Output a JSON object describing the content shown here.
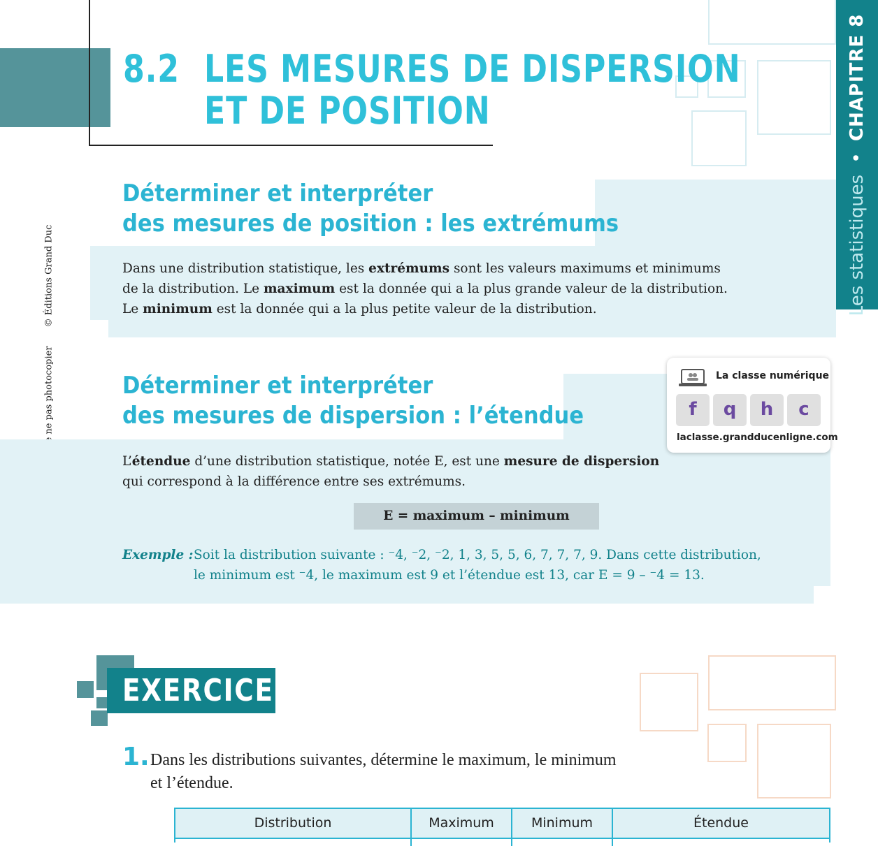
{
  "title": {
    "number": "8.2",
    "line1": "LES MESURES DE DISPERSION",
    "line2": "ET DE POSITION"
  },
  "chapter_tab": {
    "label": "Les statistiques",
    "separator": "•",
    "chapter": "CHAPITRE 8"
  },
  "side_text": {
    "copyright": "© Éditions Grand Duc",
    "notice": "Merci de ne pas photocopier"
  },
  "section1": {
    "heading_line1": "Déterminer et interpréter",
    "heading_line2": "des mesures de position : les extrémums",
    "p1": [
      "Dans une distribution statistique, les ",
      "extrémums",
      " sont les valeurs maximums et minimums"
    ],
    "p2": [
      "de la distribution. Le ",
      "maximum",
      " est la donnée qui a la plus grande valeur de la distribution."
    ],
    "p3": [
      "Le ",
      "minimum",
      " est la donnée qui a la plus petite valeur de la distribution."
    ]
  },
  "section2": {
    "heading_line1": "Déterminer et interpréter",
    "heading_line2": "des mesures de dispersion : l’étendue",
    "p1": [
      "L’",
      "étendue",
      " d’une distribution statistique, notée E, est une ",
      "mesure de dispersion"
    ],
    "p2": "qui correspond à la différence entre ses extrémums.",
    "formula": "E = maximum – minimum",
    "example_label": "Exemple :",
    "example_line1": "Soit la distribution suivante : ⁻4, ⁻2, ⁻2, 1, 3, 5, 5, 6, 7, 7, 7, 9. Dans cette distribution,",
    "example_line2": "le minimum est ⁻4, le maximum est 9 et l’étendue est 13, car E = 9 – ⁻4 = 13."
  },
  "numeric_card": {
    "title": "La classe numérique",
    "buttons": [
      "f",
      "q",
      "h",
      "c"
    ],
    "url": "laclasse.grandducenligne.com",
    "icon": "laptop-icon"
  },
  "exercises": {
    "title": "EXERCICES",
    "q1_number": "1.",
    "q1_line1": "Dans les distributions suivantes, détermine le maximum, le minimum",
    "q1_line2": "et l’étendue.",
    "table_headers": [
      "Distribution",
      "Maximum",
      "Minimum",
      "Étendue"
    ]
  },
  "colors": {
    "teal": "#12828b",
    "cyan": "#2bb4d2",
    "light_band": "#e2f2f6",
    "button_letter": "#6b4aa0"
  }
}
